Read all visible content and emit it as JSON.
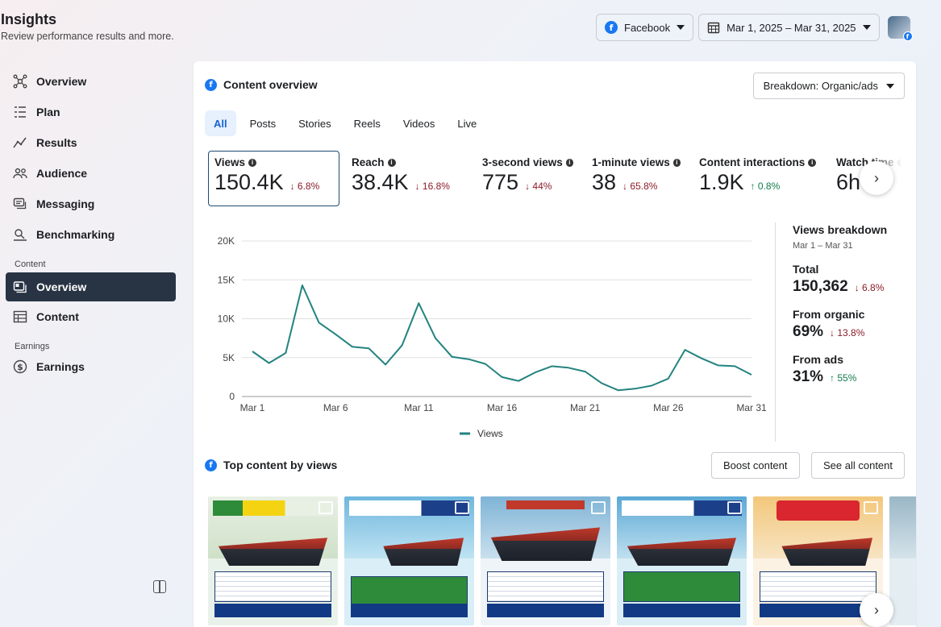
{
  "header": {
    "title": "Insights",
    "subtitle": "Review performance results and more.",
    "platform_label": "Facebook",
    "date_range": "Mar 1, 2025 – Mar 31, 2025"
  },
  "sidebar": {
    "items": [
      {
        "label": "Overview",
        "icon": "network-icon"
      },
      {
        "label": "Plan",
        "icon": "list-icon"
      },
      {
        "label": "Results",
        "icon": "trend-icon"
      },
      {
        "label": "Audience",
        "icon": "people-icon"
      },
      {
        "label": "Messaging",
        "icon": "chat-icon"
      },
      {
        "label": "Benchmarking",
        "icon": "benchmark-icon"
      }
    ],
    "content_section": "Content",
    "content_items": [
      {
        "label": "Overview",
        "icon": "content-overview-icon",
        "active": true
      },
      {
        "label": "Content",
        "icon": "table-icon"
      }
    ],
    "earnings_section": "Earnings",
    "earnings_items": [
      {
        "label": "Earnings",
        "icon": "dollar-icon"
      }
    ]
  },
  "content_overview": {
    "title": "Content overview",
    "breakdown_label": "Breakdown: Organic/ads",
    "tabs": [
      "All",
      "Posts",
      "Stories",
      "Reels",
      "Videos",
      "Live"
    ],
    "active_tab": "All",
    "metrics": [
      {
        "name": "Views",
        "value": "150.4K",
        "delta": "6.8%",
        "dir": "down"
      },
      {
        "name": "Reach",
        "value": "38.4K",
        "delta": "16.8%",
        "dir": "down"
      },
      {
        "name": "3-second views",
        "value": "775",
        "delta": "44%",
        "dir": "down"
      },
      {
        "name": "1-minute views",
        "value": "38",
        "delta": "65.8%",
        "dir": "down"
      },
      {
        "name": "Content interactions",
        "value": "1.9K",
        "delta": "0.8%",
        "dir": "up"
      },
      {
        "name": "Watch time",
        "value": "6h",
        "delta": "",
        "dir": "none"
      }
    ]
  },
  "views_breakdown": {
    "title": "Views breakdown",
    "range": "Mar 1 – Mar 31",
    "total_label": "Total",
    "total_value": "150,362",
    "total_delta": "6.8%",
    "organic_label": "From organic",
    "organic_value": "69%",
    "organic_delta": "13.8%",
    "ads_label": "From ads",
    "ads_value": "31%",
    "ads_delta": "55%"
  },
  "top_content": {
    "title": "Top content by views",
    "boost_label": "Boost content",
    "see_all_label": "See all content"
  },
  "colors": {
    "line": "#23837f",
    "active_nav": "#283444",
    "fb_blue": "#1877f2",
    "down": "#8c1b29",
    "up": "#137a4a"
  },
  "chart_data": {
    "type": "line",
    "x": [
      "Mar 1",
      "Mar 2",
      "Mar 3",
      "Mar 4",
      "Mar 5",
      "Mar 6",
      "Mar 7",
      "Mar 8",
      "Mar 9",
      "Mar 10",
      "Mar 11",
      "Mar 12",
      "Mar 13",
      "Mar 14",
      "Mar 15",
      "Mar 16",
      "Mar 17",
      "Mar 18",
      "Mar 19",
      "Mar 20",
      "Mar 21",
      "Mar 22",
      "Mar 23",
      "Mar 24",
      "Mar 25",
      "Mar 26",
      "Mar 27",
      "Mar 28",
      "Mar 29",
      "Mar 30",
      "Mar 31"
    ],
    "series": [
      {
        "name": "Views",
        "values": [
          5800,
          4300,
          5600,
          14300,
          9500,
          8000,
          6400,
          6200,
          4100,
          6600,
          12000,
          7500,
          5100,
          4800,
          4200,
          2500,
          2000,
          3100,
          3900,
          3700,
          3200,
          1700,
          800,
          1000,
          1400,
          2300,
          6000,
          4900,
          4000,
          3900,
          2800
        ]
      }
    ],
    "x_tick_labels": [
      "Mar 1",
      "Mar 6",
      "Mar 11",
      "Mar 16",
      "Mar 21",
      "Mar 26",
      "Mar 31"
    ],
    "y_tick_labels": [
      "0",
      "5K",
      "10K",
      "15K",
      "20K"
    ],
    "ylim": [
      0,
      20000
    ],
    "grid": true,
    "legend": "bottom-center"
  }
}
